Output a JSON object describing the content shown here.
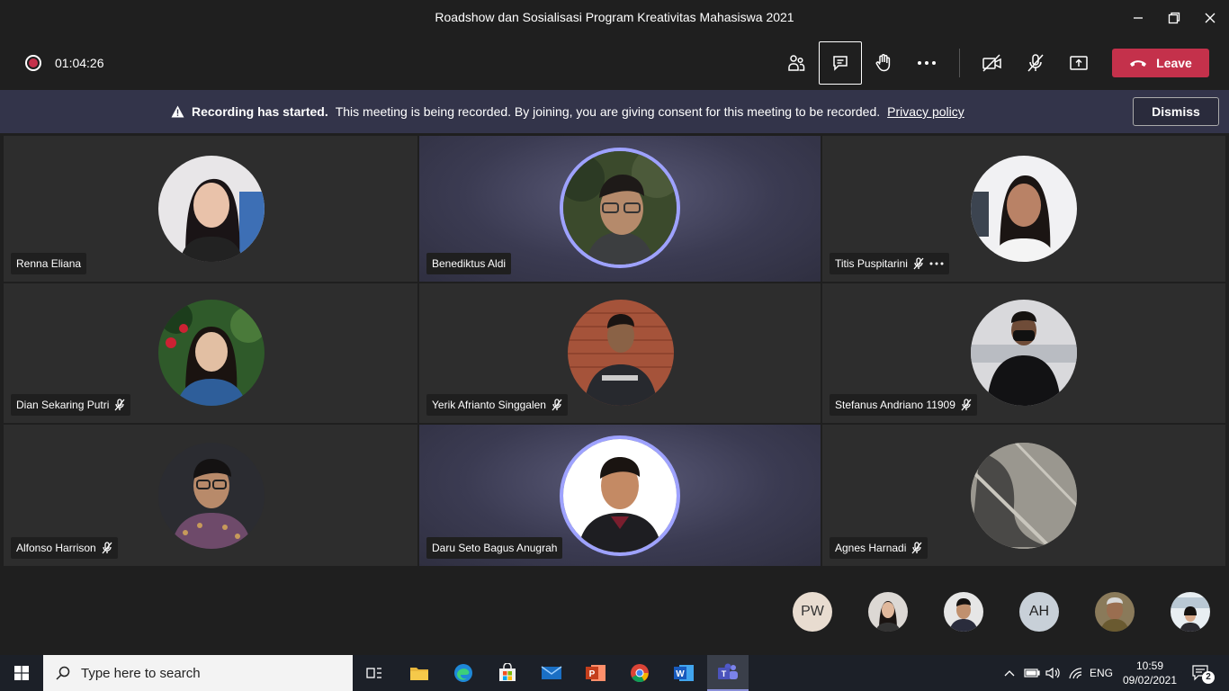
{
  "window": {
    "title": "Roadshow dan Sosialisasi Program Kreativitas Mahasiswa 2021"
  },
  "toolbar": {
    "timer": "01:04:26",
    "leave_label": "Leave"
  },
  "banner": {
    "bold_text": "Recording has started.",
    "text": "This meeting is being recorded. By joining, you are giving consent for this meeting to be recorded.",
    "link": "Privacy policy",
    "dismiss_label": "Dismiss"
  },
  "participants": [
    {
      "name": "Renna Eliana",
      "muted": false,
      "speaking": false
    },
    {
      "name": "Benediktus Aldi",
      "muted": false,
      "speaking": true
    },
    {
      "name": "Titis Puspitarini",
      "muted": true,
      "speaking": false
    },
    {
      "name": "Dian Sekaring Putri",
      "muted": true,
      "speaking": false
    },
    {
      "name": "Yerik Afrianto Singgalen",
      "muted": true,
      "speaking": false
    },
    {
      "name": "Stefanus Andriano 11909",
      "muted": true,
      "speaking": false
    },
    {
      "name": "Alfonso Harrison",
      "muted": true,
      "speaking": false
    },
    {
      "name": "Daru Seto Bagus Anugrah",
      "muted": false,
      "speaking": true
    },
    {
      "name": "Agnes Harnadi",
      "muted": true,
      "speaking": false
    }
  ],
  "strip": {
    "initials_1": "PW",
    "initials_2": "AH"
  },
  "taskbar": {
    "search_placeholder": "Type here to search",
    "language": "ENG",
    "time": "10:59",
    "date": "09/02/2021",
    "notification_count": "2"
  },
  "colors": {
    "leave_red": "#c4314b",
    "banner_bg": "#33344a",
    "speaking_ring": "#9ea2ff"
  }
}
